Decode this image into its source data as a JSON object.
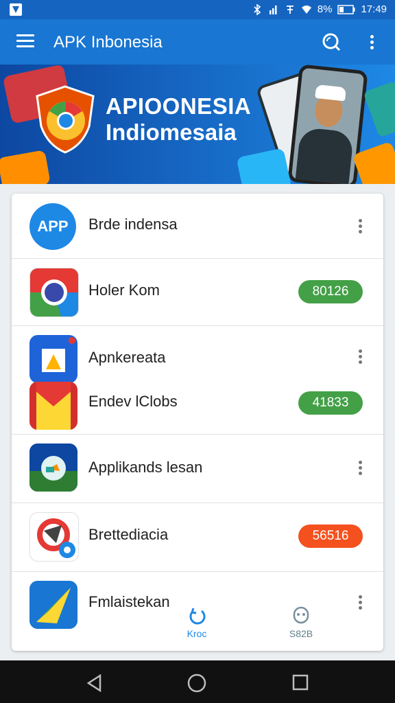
{
  "status_bar": {
    "battery": "8%",
    "time": "17:49"
  },
  "app_bar": {
    "title": "APK Inbonesia"
  },
  "banner": {
    "line1": "APIOONESIA",
    "line2": "Indiomesaia"
  },
  "list": [
    {
      "name": "Brde indensa",
      "icon": "app-logo-icon",
      "badge": null,
      "menu": true
    },
    {
      "name": "Holer Kom",
      "icon": "chrome-icon",
      "badge": "80126",
      "badge_color": "#43a047",
      "menu": false
    },
    {
      "name": "Apnkereata",
      "icon": "notification-app-icon",
      "badge": null,
      "menu": true
    },
    {
      "name": "Endev lClobs",
      "icon": "gmail-icon",
      "badge": "41833",
      "badge_color": "#43a047",
      "menu": false
    },
    {
      "name": "Applikands lesan",
      "icon": "maps-app-icon",
      "badge": null,
      "menu": true
    },
    {
      "name": "Brettediacia",
      "icon": "messenger-app-icon",
      "badge": "56516",
      "badge_color": "#f4511e",
      "menu": false
    },
    {
      "name": "Fmlaistekan",
      "icon": "arrow-app-icon",
      "badge": null,
      "menu": true
    }
  ],
  "bottom_tabs": [
    {
      "label": "Kroc",
      "icon": "refresh-swirl-icon",
      "active": true
    },
    {
      "label": "S82B",
      "icon": "ghost-icon",
      "active": false
    }
  ],
  "colors": {
    "primary": "#1976d2",
    "status": "#1565c0",
    "green": "#43a047",
    "orange": "#f4511e"
  }
}
